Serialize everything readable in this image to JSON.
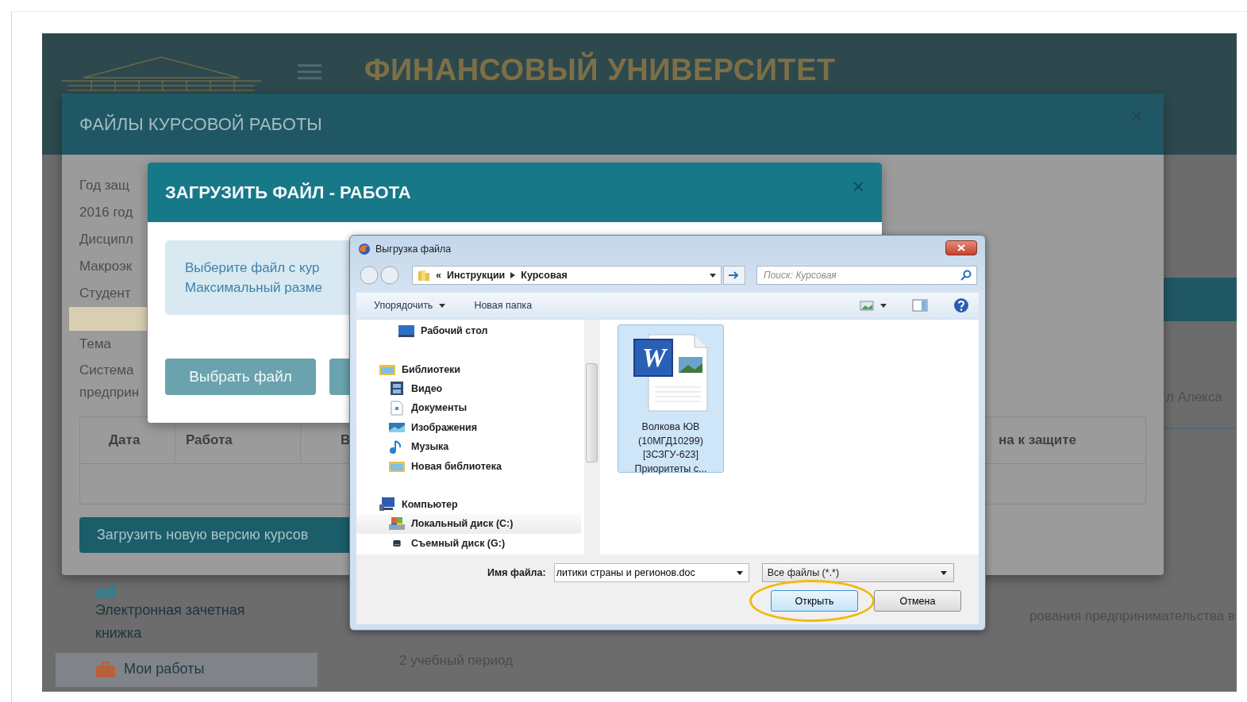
{
  "background_page": {
    "header_title": "ФИНАНСОВЫЙ УНИВЕРСИТЕТ",
    "sidebar": [
      {
        "label": "Электронная зачетная книжка",
        "kind": "chart",
        "selected": false
      },
      {
        "label": "Мои работы",
        "kind": "briefcase",
        "selected": true
      }
    ],
    "side_text": "л Алекса",
    "row_text": "рования предпринимательства в",
    "period": "2 учебный период"
  },
  "course_files_modal": {
    "title": "ФАЙЛЫ КУРСОВОЙ РАБОТЫ",
    "close": "×",
    "fields": [
      "Год защ",
      "2016 год",
      "Дисципл",
      "Макроэк",
      "Студент"
    ],
    "topic_label": "Тема",
    "topic_lines": [
      "Система",
      "предприн"
    ],
    "table_columns": [
      "Дата",
      "Работа",
      "В",
      "на к защите"
    ],
    "upload_button": "Загрузить новую версию курсов"
  },
  "upload_modal": {
    "title": "ЗАГРУЗИТЬ ФАЙЛ - РАБОТА",
    "close": "×",
    "info_lines": [
      "Выберите файл с кур",
      "Максимальный разме"
    ],
    "choose_button": "Выбрать файл"
  },
  "file_dialog": {
    "title": "Выгрузка файла",
    "path_prefix": "«",
    "path": [
      "Инструкции",
      "Курсовая"
    ],
    "search": {
      "placeholder": "Поиск: Курсовая"
    },
    "toolbar": [
      {
        "label": "Упорядочить",
        "dropdown": true
      },
      {
        "label": "Новая папка",
        "dropdown": false
      }
    ],
    "tree": [
      {
        "children": [
          {
            "label": "Рабочий стол",
            "kind": "desktop",
            "selected": false
          }
        ]
      },
      {
        "label": "Библиотеки",
        "kind": "library",
        "selected": false,
        "children": [
          {
            "label": "Видео",
            "kind": "video",
            "selected": false
          },
          {
            "label": "Документы",
            "kind": "document",
            "selected": false
          },
          {
            "label": "Изображения",
            "kind": "pictures",
            "selected": false
          },
          {
            "label": "Музыка",
            "kind": "music",
            "selected": false
          },
          {
            "label": "Новая библиотека",
            "kind": "library",
            "selected": false
          }
        ]
      },
      {
        "label": "Компьютер",
        "kind": "computer",
        "selected": false,
        "children": [
          {
            "label": "Локальный диск (C:)",
            "kind": "drive",
            "selected": true
          },
          {
            "label": "Съемный диск (G:)",
            "kind": "removable",
            "selected": false
          }
        ]
      }
    ],
    "files": [
      {
        "icon_letter": "W",
        "name_lines": [
          "Волкова ЮВ",
          "(10МГД10299)",
          "[3СЗГУ-623]",
          "Приоритеты с..."
        ],
        "selected": true
      }
    ],
    "filename_label": "Имя файла:",
    "filename": "литики страны и регионов.doc",
    "filetype": "Все файлы (*.*)",
    "buttons": [
      {
        "label": "Открыть",
        "default": true,
        "highlighted": true
      },
      {
        "label": "Отмена",
        "default": false,
        "highlighted": false
      }
    ]
  }
}
